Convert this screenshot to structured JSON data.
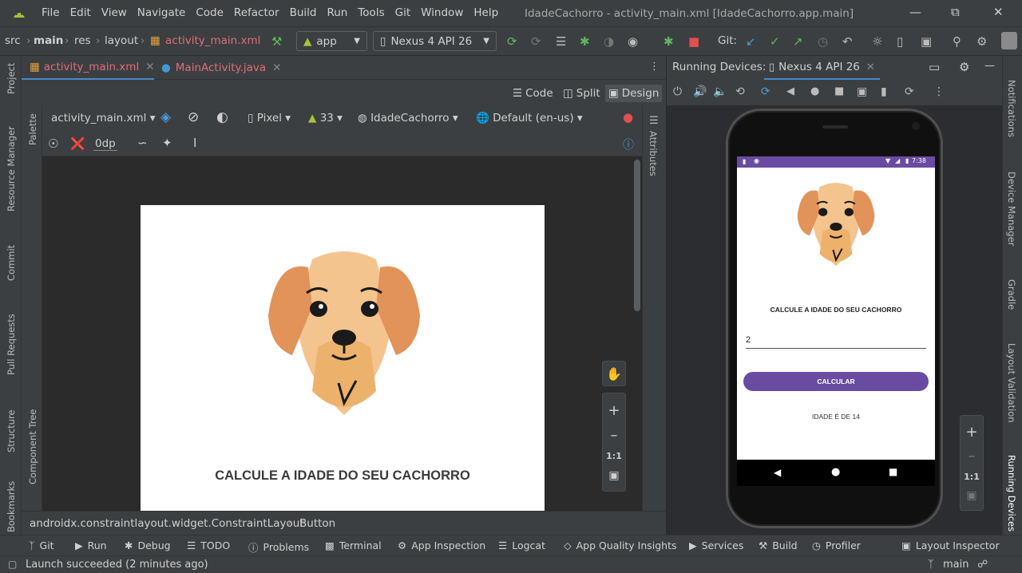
{
  "titlebar": {
    "menu": [
      "File",
      "Edit",
      "View",
      "Navigate",
      "Code",
      "Refactor",
      "Build",
      "Run",
      "Tools",
      "Git",
      "Window",
      "Help"
    ],
    "title": "IdadeCachorro - activity_main.xml [IdadeCachorro.app.main]"
  },
  "navbar": {
    "breadcrumb": [
      "src",
      "main",
      "res",
      "layout",
      "activity_main.xml"
    ],
    "run_config": "app",
    "device": "Nexus 4 API 26",
    "git_label": "Git:"
  },
  "left_stripe": [
    "Project",
    "Resource Manager",
    "Commit",
    "Pull Requests",
    "Structure",
    "Bookmarks"
  ],
  "right_stripe": [
    "Notifications",
    "Device Manager",
    "Gradle",
    "Layout Validation",
    "Running Devices"
  ],
  "editor_tabs": [
    {
      "label": "activity_main.xml",
      "active": true
    },
    {
      "label": "MainActivity.java",
      "active": false
    }
  ],
  "view_modes": {
    "code": "Code",
    "split": "Split",
    "design": "Design"
  },
  "palette_stripe": {
    "palette": "Palette",
    "component_tree": "Component Tree"
  },
  "attributes_label": "Attributes",
  "design_toolbar": {
    "file": "activity_main.xml",
    "device": "Pixel",
    "api": "33",
    "theme": "IdadeCachorro",
    "locale": "Default (en-us)",
    "margin": "0dp"
  },
  "preview": {
    "heading": "CALCULE A IDADE DO SEU CACHORRO"
  },
  "zoom": {
    "ratio": "1:1"
  },
  "component_breadcrumb": [
    "androidx.constraintlayout.widget.ConstraintLayout",
    "Button"
  ],
  "running_devices": {
    "label": "Running Devices:",
    "tab": "Nexus 4 API 26"
  },
  "phone": {
    "time": "7:38",
    "heading": "CALCULE A IDADE DO SEU CACHORRO",
    "input_value": "2",
    "button_label": "CALCULAR",
    "result": "IDADE É DE 14"
  },
  "tool_windows": [
    "Git",
    "Run",
    "Debug",
    "TODO",
    "Problems",
    "Terminal",
    "App Inspection",
    "Logcat",
    "App Quality Insights",
    "Services",
    "Build",
    "Profiler",
    "Layout Inspector"
  ],
  "status": {
    "message": "Launch succeeded (2 minutes ago)",
    "branch": "main"
  },
  "colors": {
    "accent": "#6a4ba2",
    "tab_active": "#e06c75",
    "android_green": "#a4c639"
  }
}
